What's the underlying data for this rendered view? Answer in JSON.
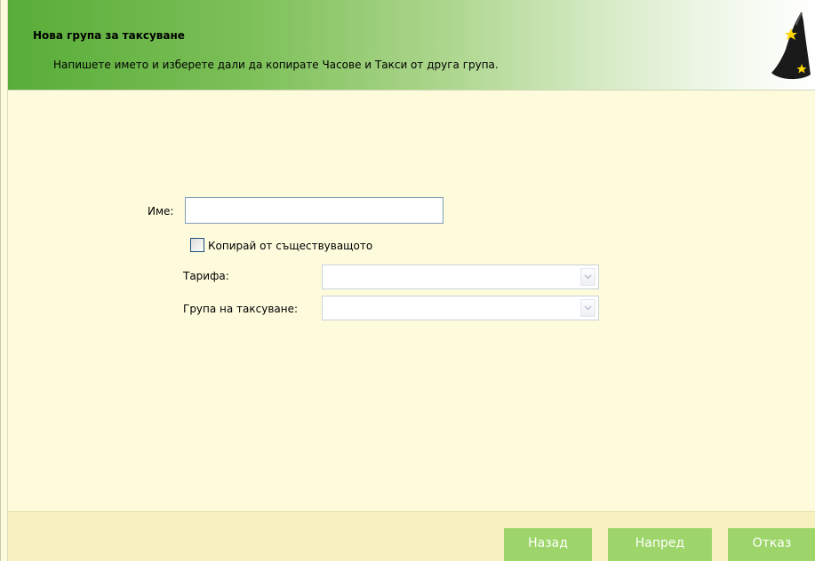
{
  "header": {
    "title": "Нова група за таксуване",
    "subtitle": "Напишете името и изберете дали да копирате Часове и Такси от друга група.",
    "icon": "wizard-hat-icon"
  },
  "form": {
    "name_label": "Име:",
    "name_value": "",
    "copy_checkbox_label": "Копирай от съществуващото",
    "copy_checked": false,
    "tariff_label": "Тарифа:",
    "tariff_value": "",
    "group_label": "Група на таксуване:",
    "group_value": ""
  },
  "footer": {
    "back_label": "Назад",
    "next_label": "Напред",
    "cancel_label": "Отказ"
  },
  "colors": {
    "header_green": "#58ad38",
    "body_bg": "#fdfbdc",
    "footer_bg": "#f7f1c2",
    "button_green": "#9ed56a"
  }
}
